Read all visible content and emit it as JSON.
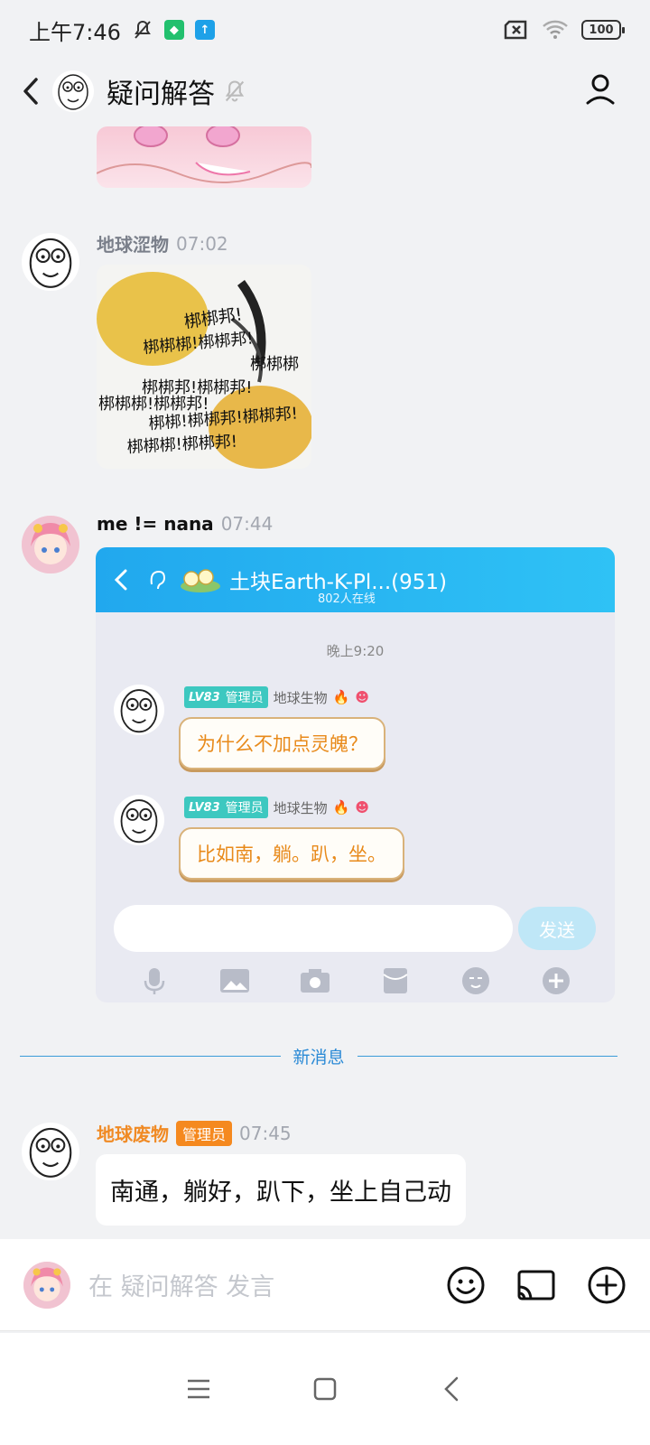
{
  "status_bar": {
    "time": "上午7:46",
    "battery": "100"
  },
  "header": {
    "title": "疑问解答"
  },
  "messages": [
    {
      "sender": "地球涩物",
      "time": "07:02",
      "type": "image"
    },
    {
      "sender": "me != nana",
      "time": "07:44",
      "type": "screenshot",
      "screenshot": {
        "group_title": "土块Earth-K-Pl...(951)",
        "online": "802人在线",
        "time_divider": "晚上9:20",
        "messages": [
          {
            "level": "LV83",
            "role": "管理员",
            "sender": "地球生物",
            "text": "为什么不加点灵魄？"
          },
          {
            "level": "LV83",
            "role": "管理员",
            "sender": "地球生物",
            "text": "比如南，躺。趴，坐。"
          }
        ],
        "send_label": "发送"
      }
    },
    {
      "sender": "地球废物",
      "badge": "管理员",
      "time": "07:45",
      "type": "text",
      "text": "南通，躺好，趴下，坐上自己动"
    }
  ],
  "image_text": [
    "梆梆邦!",
    "梆梆梆!梆梆邦!",
    "梆梆梆",
    "梆梆邦!梆梆邦!",
    "梆梆梆!梆梆邦!",
    "梆梆!梆梆邦!梆梆邦!",
    "梆梆梆!梆梆邦!"
  ],
  "new_messages_label": "新消息",
  "input": {
    "placeholder": "在 疑问解答 发言"
  },
  "colors": {
    "accent": "#2a8ad6",
    "admin": "#f5891f",
    "chat_header": "#21a8ee"
  }
}
